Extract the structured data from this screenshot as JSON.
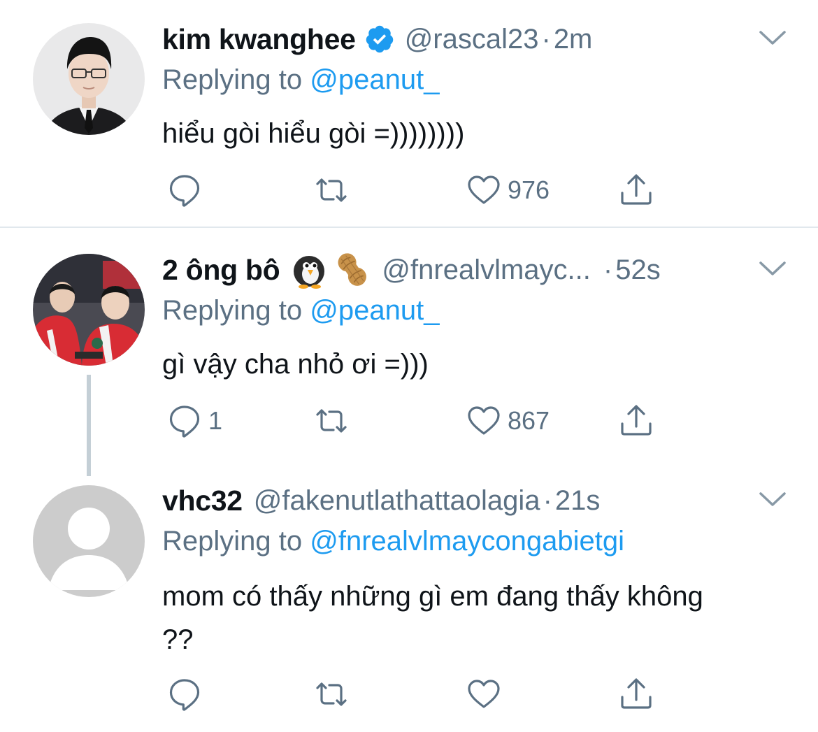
{
  "tweets": [
    {
      "name": "kim kwanghee",
      "verified": true,
      "handle": "@rascal23",
      "sep": "·",
      "time": "2m",
      "replying_prefix": "Replying to",
      "replying_to": "@peanut_",
      "text": "hiểu gòi hiểu gòi =))))))))",
      "reply_count": "",
      "like_count": "976",
      "avatar_icon": "person-photo-icon"
    },
    {
      "name": "2 ông bô",
      "verified": false,
      "emojis": [
        "penguin-emoji",
        "peanut-emoji"
      ],
      "handle": "@fnrealvlmayc...",
      "sep": "·",
      "time": "52s",
      "replying_prefix": "Replying to",
      "replying_to": "@peanut_",
      "text": "gì vậy cha nhỏ ơi =)))",
      "reply_count": "1",
      "like_count": "867",
      "avatar_icon": "group-photo-icon"
    },
    {
      "name": "vhc32",
      "verified": false,
      "handle": "@fakenutlathattaolagia",
      "sep": "·",
      "time": "21s",
      "replying_prefix": "Replying to",
      "replying_to": "@fnrealvlmaycongabietgi",
      "text": "mom có thấy những gì em đang thấy không ??",
      "reply_count": "",
      "like_count": "",
      "avatar_icon": "default-avatar-icon"
    }
  ],
  "colors": {
    "text_primary": "#0f1419",
    "text_secondary": "#5b7083",
    "accent": "#1d9bf0",
    "divider": "#e1e8ed",
    "thread_line": "#c4cfd6"
  }
}
